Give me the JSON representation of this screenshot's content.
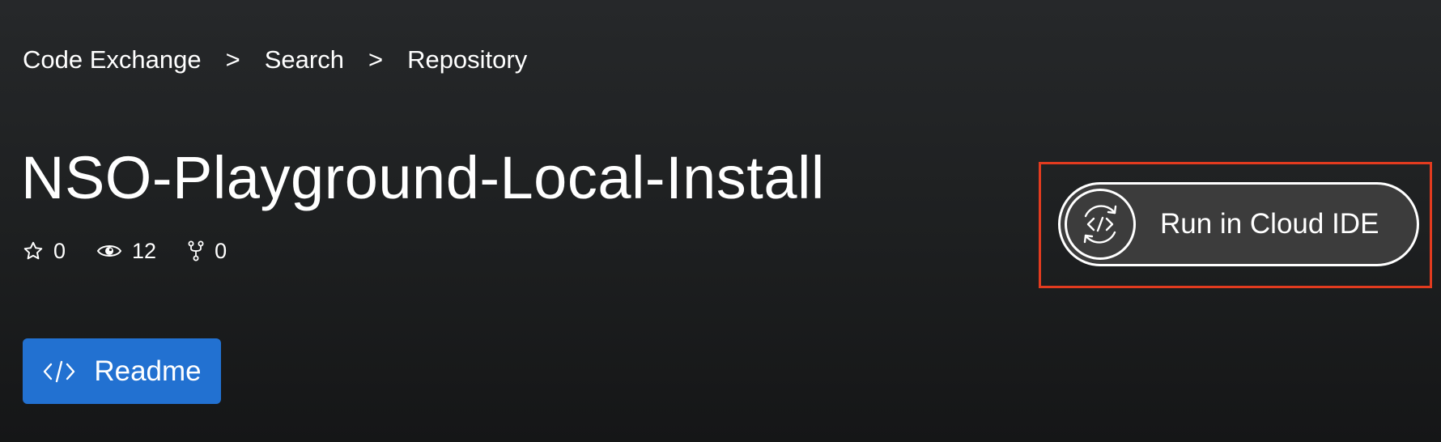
{
  "breadcrumb": {
    "items": [
      "Code Exchange",
      "Search",
      "Repository"
    ],
    "separator": ">"
  },
  "repo": {
    "title": "NSO-Playground-Local-Install"
  },
  "stats": {
    "stars": "0",
    "watchers": "12",
    "forks": "0"
  },
  "actions": {
    "readme_label": "Readme",
    "cloud_ide_label": "Run in Cloud IDE"
  },
  "colors": {
    "primary_button": "#2271d1",
    "highlight_border": "#e23b1f",
    "background": "#1f2122"
  },
  "icons": {
    "stars": "star-outline-icon",
    "watchers": "eye-icon",
    "forks": "fork-icon",
    "readme": "code-brackets-icon",
    "cloud_ide": "code-refresh-icon"
  }
}
